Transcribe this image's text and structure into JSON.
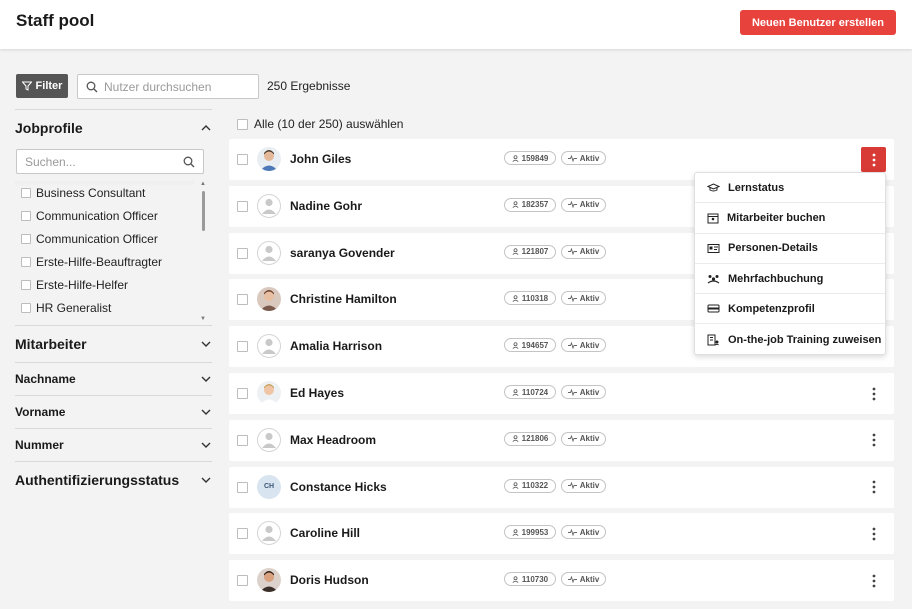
{
  "header": {
    "title": "Staff pool",
    "create_button": "Neuen Benutzer erstellen"
  },
  "toolbar": {
    "filter_label": "Filter",
    "search_placeholder": "Nutzer durchsuchen",
    "result_count": "250 Ergebnisse"
  },
  "sidebar": {
    "jobprofile": {
      "label": "Jobprofile",
      "expanded": true,
      "search_placeholder": "Suchen...",
      "items": [
        {
          "label": "Business Consultant"
        },
        {
          "label": "Communication Officer"
        },
        {
          "label": "Communication Officer"
        },
        {
          "label": "Erste-Hilfe-Beauftragter"
        },
        {
          "label": "Erste-Hilfe-Helfer"
        },
        {
          "label": "HR Generalist"
        }
      ]
    },
    "sections": [
      {
        "label": "Mitarbeiter",
        "size": "large"
      },
      {
        "label": "Nachname",
        "size": "small"
      },
      {
        "label": "Vorname",
        "size": "small"
      },
      {
        "label": "Nummer",
        "size": "small"
      },
      {
        "label": "Authentifizierungsstatus",
        "size": "large"
      }
    ]
  },
  "list": {
    "select_all_label": "Alle (10 der 250) auswählen",
    "users": [
      {
        "name": "John Giles",
        "id": "159849",
        "status": "Aktiv",
        "avatar": "photo-man-blue",
        "menu_open": true
      },
      {
        "name": "Nadine Gohr",
        "id": "182357",
        "status": "Aktiv",
        "avatar": "generic"
      },
      {
        "name": "saranya Govender",
        "id": "121807",
        "status": "Aktiv",
        "avatar": "generic"
      },
      {
        "name": "Christine Hamilton",
        "id": "110318",
        "status": "Aktiv",
        "avatar": "photo-woman-brown"
      },
      {
        "name": "Amalia Harrison",
        "id": "194657",
        "status": "Aktiv",
        "avatar": "generic"
      },
      {
        "name": "Ed Hayes",
        "id": "110724",
        "status": "Aktiv",
        "avatar": "photo-man-blond"
      },
      {
        "name": "Max Headroom",
        "id": "121806",
        "status": "Aktiv",
        "avatar": "generic"
      },
      {
        "name": "Constance Hicks",
        "id": "110322",
        "status": "Aktiv",
        "avatar": "initials",
        "initials": "CH"
      },
      {
        "name": "Caroline Hill",
        "id": "199953",
        "status": "Aktiv",
        "avatar": "generic"
      },
      {
        "name": "Doris Hudson",
        "id": "110730",
        "status": "Aktiv",
        "avatar": "photo-woman-dark"
      }
    ]
  },
  "context_menu": {
    "items": [
      {
        "label": "Lernstatus",
        "icon": "graduation-cap-icon"
      },
      {
        "label": "Mitarbeiter buchen",
        "icon": "calendar-user-icon"
      },
      {
        "label": "Personen-Details",
        "icon": "id-card-icon"
      },
      {
        "label": "Mehrfachbuchung",
        "icon": "group-icon"
      },
      {
        "label": "Kompetenzprofil",
        "icon": "profile-card-icon"
      },
      {
        "label": "On-the-job Training zuweisen",
        "icon": "training-assign-icon"
      }
    ]
  },
  "colors": {
    "accent": "#e8423c",
    "accent_dark": "#d83a35",
    "filter_button": "#555555",
    "background": "#f3f3f3"
  }
}
